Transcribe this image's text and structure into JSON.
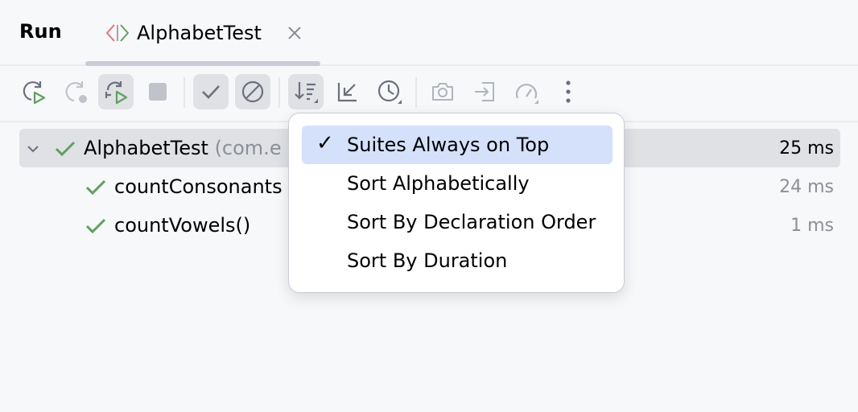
{
  "header": {
    "title": "Run",
    "tab": {
      "label": "AlphabetTest",
      "close_icon": "close-icon",
      "icon": "test-class-icon"
    }
  },
  "toolbar": {
    "buttons": [
      {
        "name": "rerun-button",
        "icon": "rerun-icon",
        "active": false
      },
      {
        "name": "rerun-failed-button",
        "icon": "rerun-failed-icon",
        "active": false
      },
      {
        "name": "toggle-auto-test-button",
        "icon": "auto-rerun-icon",
        "active": true
      },
      {
        "name": "stop-button",
        "icon": "stop-icon",
        "active": false
      },
      {
        "name": "show-passed-button",
        "icon": "checkmark-icon",
        "active": true
      },
      {
        "name": "show-ignored-button",
        "icon": "ignored-icon",
        "active": true
      },
      {
        "name": "sort-button",
        "icon": "sort-icon",
        "active": true
      },
      {
        "name": "collapse-all-button",
        "icon": "collapse-icon",
        "active": false
      },
      {
        "name": "test-history-button",
        "icon": "history-icon",
        "active": false
      },
      {
        "name": "screenshot-button",
        "icon": "camera-icon",
        "active": false
      },
      {
        "name": "import-tests-button",
        "icon": "import-icon",
        "active": false
      },
      {
        "name": "profiler-button",
        "icon": "gauge-icon",
        "active": false
      },
      {
        "name": "more-button",
        "icon": "more-vertical-icon",
        "active": false
      }
    ]
  },
  "tree": {
    "root": {
      "name": "AlphabetTest",
      "package": "(com.e",
      "time": "25 ms",
      "status": "passed"
    },
    "children": [
      {
        "name": "countConsonants",
        "time": "24 ms",
        "status": "passed"
      },
      {
        "name": "countVowels()",
        "time": "1 ms",
        "status": "passed"
      }
    ]
  },
  "sort_menu": {
    "items": [
      {
        "label": "Suites Always on Top",
        "checked": true,
        "check_mark": "✓"
      },
      {
        "label": "Sort Alphabetically",
        "checked": false
      },
      {
        "label": "Sort By Declaration Order",
        "checked": false
      },
      {
        "label": "Sort By Duration",
        "checked": false
      }
    ]
  },
  "colors": {
    "pass_green": "#5fa060",
    "menu_selected": "#d5e1fb",
    "row_selected": "#dfe1e5",
    "icon_gray": "#6c707e"
  }
}
